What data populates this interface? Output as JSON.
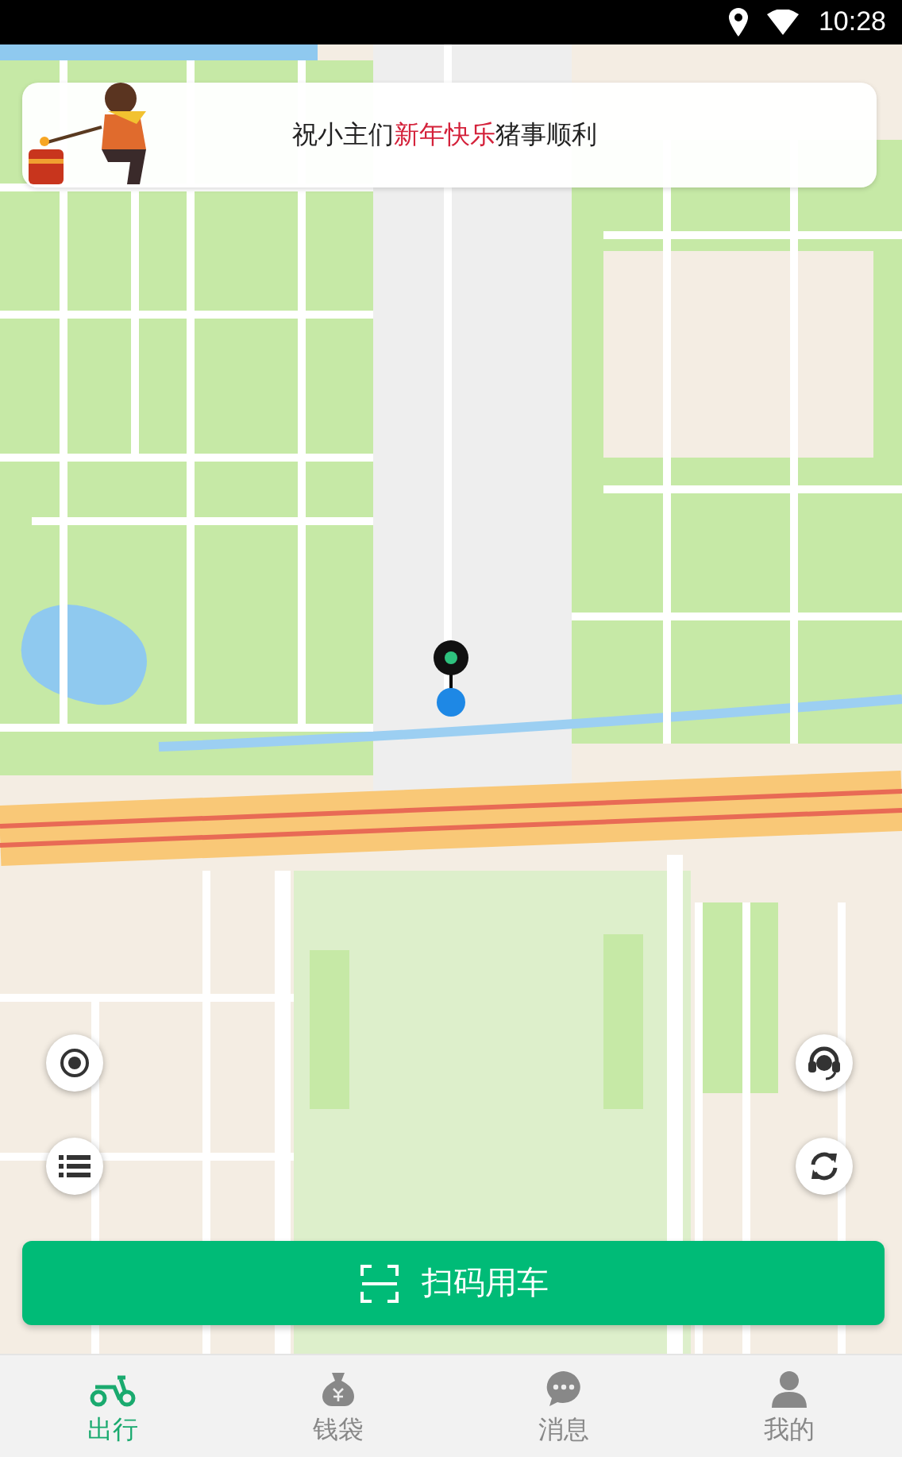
{
  "status_bar": {
    "time": "10:28"
  },
  "banner": {
    "segments": [
      {
        "text": "祝小主们",
        "highlight": false
      },
      {
        "text": "新年快乐",
        "highlight": true
      },
      {
        "text": "猪事顺利",
        "highlight": false
      }
    ]
  },
  "scan_button": {
    "label": "扫码用车"
  },
  "tabs": [
    {
      "label": "出行",
      "kind": "scooter",
      "selected": true
    },
    {
      "label": "钱袋",
      "kind": "bag",
      "selected": false
    },
    {
      "label": "消息",
      "kind": "chat",
      "selected": false
    },
    {
      "label": "我的",
      "kind": "person",
      "selected": false
    }
  ]
}
